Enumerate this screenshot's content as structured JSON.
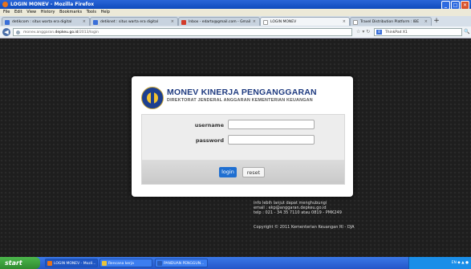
{
  "window": {
    "title": "LOGIN MONEV - Mozilla Firefox"
  },
  "menu": [
    "File",
    "Edit",
    "View",
    "History",
    "Bookmarks",
    "Tools",
    "Help"
  ],
  "tabs": [
    {
      "label": "detikcom : situs warta era digital",
      "icon_color": "#3a6fd8"
    },
    {
      "label": "detiknet : situs warta era digital",
      "icon_color": "#3a6fd8"
    },
    {
      "label": "Inbox - edarto@gmail.com - Gmail",
      "icon_color": "#d23b2a"
    },
    {
      "label": "LOGIN MONEV",
      "icon_color": "#ffffff"
    },
    {
      "label": "Travel Distribution Platform : IBE",
      "icon_color": "#ffffff"
    }
  ],
  "tab_close": "×",
  "new_tab": "+",
  "address": {
    "prefix": "monev.anggaran.",
    "domain": "depkeu.go.id",
    "path": "/2013/login"
  },
  "search": {
    "engine": "Google",
    "engine_icon": "8",
    "value": "ThinkPad X1"
  },
  "nav_icons": [
    "back-arrow-icon",
    "star-icon",
    "reload-icon"
  ],
  "panel": {
    "title": "MONEV KINERJA PENGANGGARAN",
    "subtitle": "DIREKTORAT JENDERAL ANGGARAN KEMENTERIAN KEUANGAN",
    "username_label": "username",
    "password_label": "password",
    "username_value": "",
    "password_value": "",
    "login_label": "login",
    "reset_label": "reset"
  },
  "footer": {
    "info_line1": "info lebih lanjut dapat menghubungi",
    "info_line2": "email : ekp@anggaran.depkeu.go.id",
    "info_line3": "telp : 021 - 34 35 7110 atau 0819 - PMK249",
    "copyright": "Copyright © 2011 Kementerian Keuangan RI - DJA"
  },
  "taskbar": {
    "start": "start",
    "items": [
      {
        "label": "LOGIN MONEV - Mozil...",
        "icon_color": "#e8731b"
      },
      {
        "label": "Rencana kerja",
        "icon_color": "#e8c43a"
      },
      {
        "label": "PANDUAN PENGGUN...",
        "icon_color": "#2b5cb8"
      }
    ],
    "tray": "EN"
  }
}
